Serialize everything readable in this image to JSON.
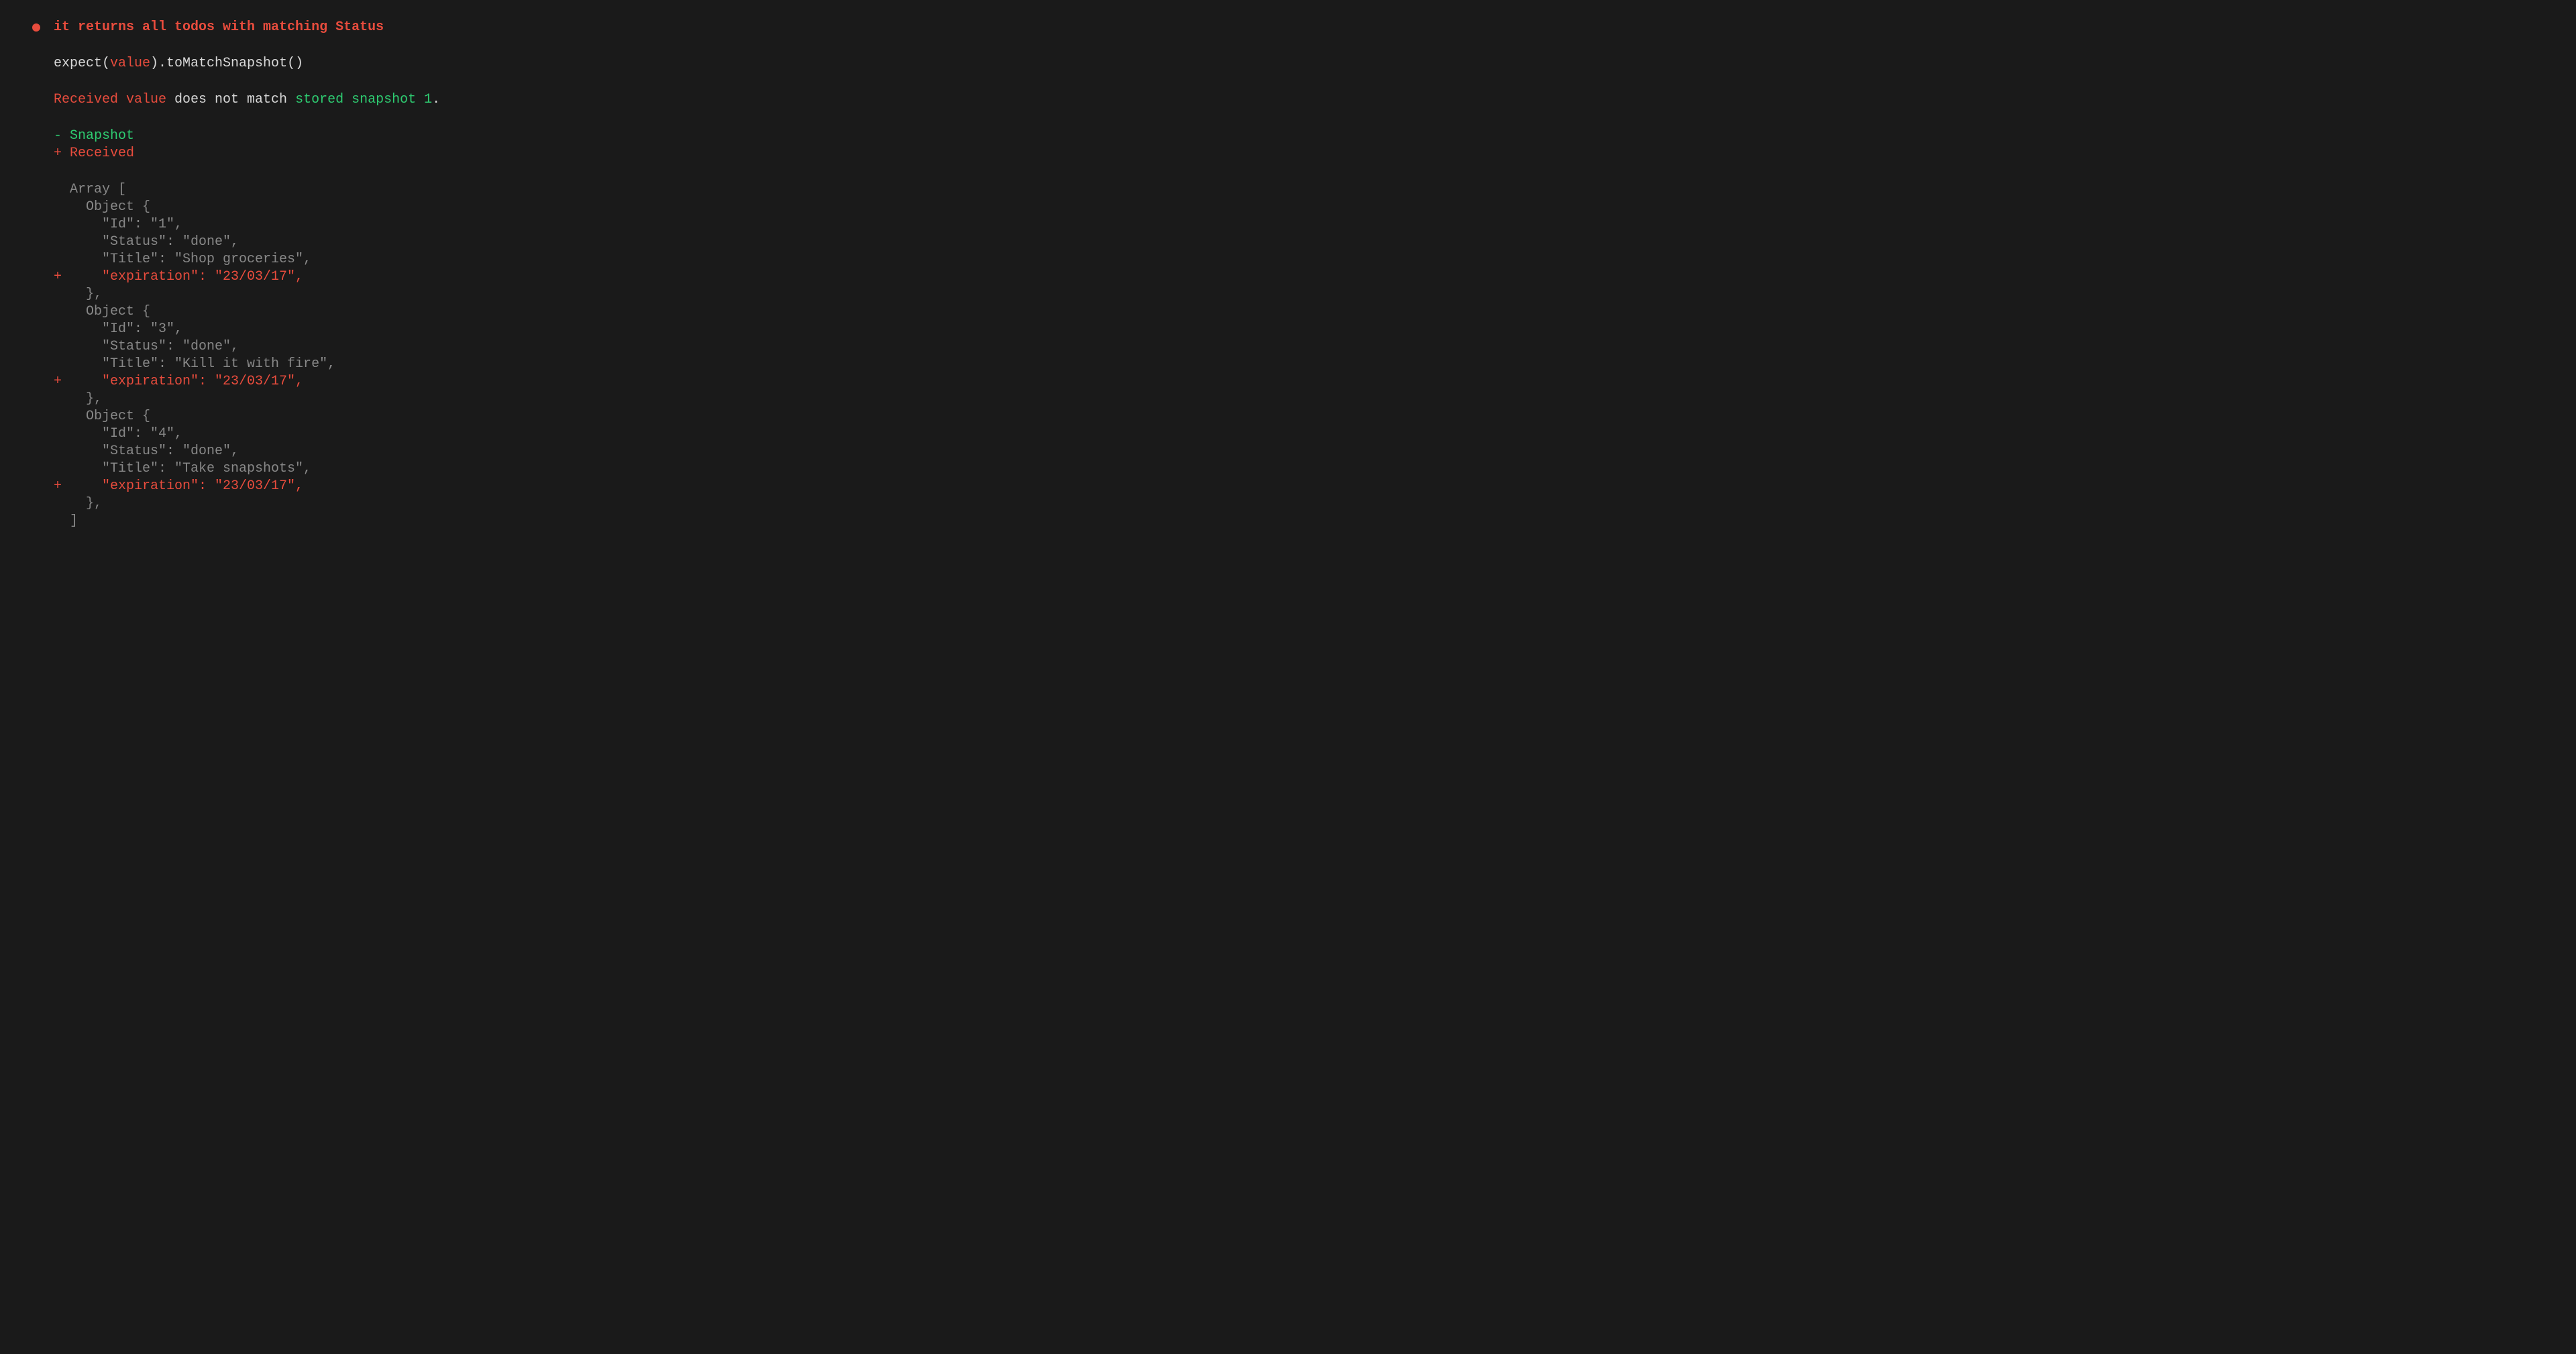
{
  "test": {
    "title": "it returns all todos with matching Status"
  },
  "expect": {
    "prefix": "expect(",
    "value": "value",
    "suffix": ").toMatchSnapshot()"
  },
  "mismatch": {
    "received_value": "Received value",
    "middle": " does not match ",
    "stored_snapshot": "stored snapshot 1",
    "period": "."
  },
  "legend": {
    "snapshot": "- Snapshot",
    "received": "+ Received"
  },
  "diff": {
    "lines": [
      {
        "type": "context",
        "text": "  Array ["
      },
      {
        "type": "context",
        "text": "    Object {"
      },
      {
        "type": "context",
        "text": "      \"Id\": \"1\","
      },
      {
        "type": "context",
        "text": "      \"Status\": \"done\","
      },
      {
        "type": "context",
        "text": "      \"Title\": \"Shop groceries\","
      },
      {
        "type": "added",
        "text": "+     \"expiration\": \"23/03/17\","
      },
      {
        "type": "context",
        "text": "    },"
      },
      {
        "type": "context",
        "text": "    Object {"
      },
      {
        "type": "context",
        "text": "      \"Id\": \"3\","
      },
      {
        "type": "context",
        "text": "      \"Status\": \"done\","
      },
      {
        "type": "context",
        "text": "      \"Title\": \"Kill it with fire\","
      },
      {
        "type": "added",
        "text": "+     \"expiration\": \"23/03/17\","
      },
      {
        "type": "context",
        "text": "    },"
      },
      {
        "type": "context",
        "text": "    Object {"
      },
      {
        "type": "context",
        "text": "      \"Id\": \"4\","
      },
      {
        "type": "context",
        "text": "      \"Status\": \"done\","
      },
      {
        "type": "context",
        "text": "      \"Title\": \"Take snapshots\","
      },
      {
        "type": "added",
        "text": "+     \"expiration\": \"23/03/17\","
      },
      {
        "type": "context",
        "text": "    },"
      },
      {
        "type": "context",
        "text": "  ]"
      }
    ]
  }
}
